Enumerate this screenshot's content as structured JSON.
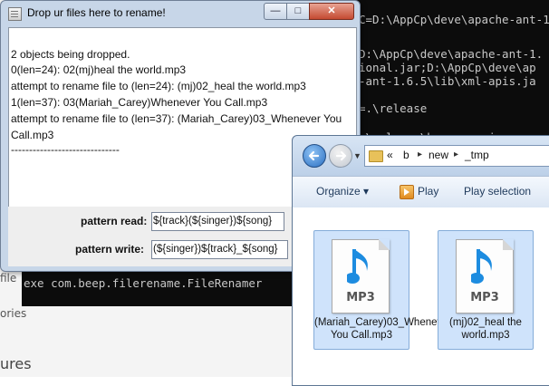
{
  "background": {
    "partial_texts": [
      "file",
      "ories",
      "ures"
    ]
  },
  "console": {
    "lines": [
      "C=D:\\AppCp\\deve\\apache-ant-1",
      "D:\\AppCp\\deve\\apache-ant-1.",
      "ional.jar;D:\\AppCp\\deve\\ap",
      "-ant-1.6.5\\lib\\xml-apis.ja",
      "=.\\release",
      ".\\release\\bep.core.jar;",
      "exe com.beep.filerename.FileRenamer"
    ]
  },
  "dialog": {
    "title": "Drop ur files here to rename!",
    "buttons": {
      "minimize": "—",
      "maximize": "□",
      "close": "✕"
    },
    "log_lines": [
      "2 objects being dropped.",
      "0(len=24): 02(mj)heal the world.mp3",
      "attempt to rename file to (len=24): (mj)02_heal the world.mp3",
      "1(len=37): 03(Mariah_Carey)Whenever You Call.mp3",
      "attempt to rename file to (len=37): (Mariah_Carey)03_Whenever You",
      "Call.mp3",
      "------------------------------"
    ],
    "pattern_read_label": "pattern read:",
    "pattern_read_value": "${track}(${singer})${song}",
    "pattern_write_label": "pattern write:",
    "pattern_write_value": "(${singer})${track}_${song}"
  },
  "explorer": {
    "breadcrumb": [
      "«",
      "b",
      "new",
      "_tmp"
    ],
    "toolbar": {
      "organize": "Organize ▾",
      "play": "Play",
      "play_selection": "Play selection"
    },
    "files": [
      {
        "icon": "mp3-file-icon",
        "type_label": "MP3",
        "name": "(Mariah_Carey)03_Whenever You Call.mp3"
      },
      {
        "icon": "mp3-file-icon",
        "type_label": "MP3",
        "name": "(mj)02_heal the world.mp3"
      }
    ]
  }
}
